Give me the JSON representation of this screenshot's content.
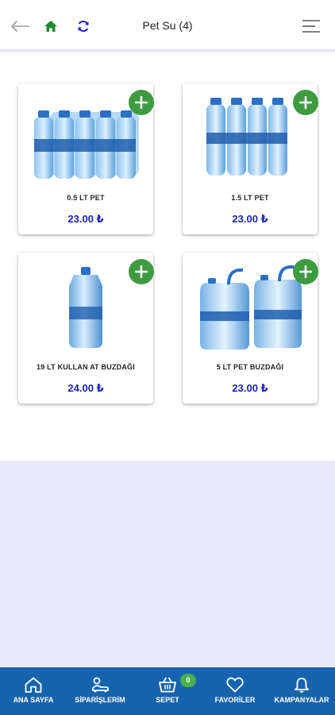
{
  "header": {
    "title": "Pet Su (4)",
    "icons": [
      "back-arrow-icon",
      "home-icon",
      "refresh-icon",
      "menu-icon"
    ],
    "colors": {
      "home": "#1e8a2e",
      "refresh": "#1a22d8",
      "back": "#9a9a9a"
    }
  },
  "products": [
    {
      "name": "0.5 LT PET",
      "price": "23.00 ₺",
      "image": "water-bottle-pack-small"
    },
    {
      "name": "1.5 LT PET",
      "price": "23.00 ₺",
      "image": "water-bottle-pack-large"
    },
    {
      "name": "19 LT KULLAN AT BUZDAĞI",
      "price": "24.00 ₺",
      "image": "water-jug-19l"
    },
    {
      "name": "5 LT PET BUZDAĞI",
      "price": "23.00 ₺",
      "image": "water-jug-5l-pair"
    }
  ],
  "bottom_nav": {
    "items": [
      {
        "label": "ANA SAYFA",
        "icon": "home-icon"
      },
      {
        "label": "SİPARİŞLERİM",
        "icon": "delivery-icon"
      },
      {
        "label": "SEPET",
        "icon": "basket-icon"
      },
      {
        "label": "FAVORİLER",
        "icon": "heart-icon"
      },
      {
        "label": "KAMPANYALAR",
        "icon": "bell-icon"
      }
    ],
    "cart_count": "0"
  },
  "colors": {
    "accent": "#1663ae",
    "add_button": "#3f9b3f",
    "price": "#1a22b8",
    "badge": "#4caf50"
  }
}
